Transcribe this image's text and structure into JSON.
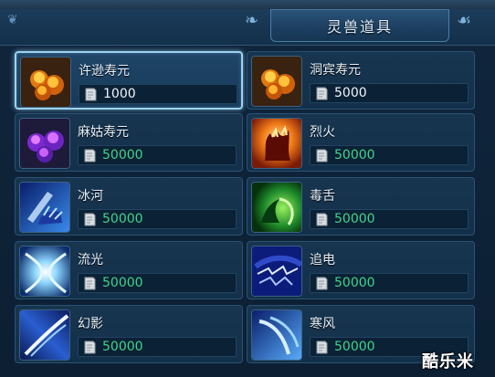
{
  "panel": {
    "title": "灵兽道具"
  },
  "items": [
    {
      "name": "许逊寿元",
      "price": "1000",
      "icon": "golden-orbs-icon",
      "selected": true
    },
    {
      "name": "洞宾寿元",
      "price": "5000",
      "icon": "golden-orbs-icon",
      "selected": false
    },
    {
      "name": "麻姑寿元",
      "price": "50000",
      "icon": "purple-orbs-icon",
      "selected": false
    },
    {
      "name": "烈火",
      "price": "50000",
      "icon": "fire-claw-icon",
      "selected": false
    },
    {
      "name": "冰河",
      "price": "50000",
      "icon": "ice-claw-icon",
      "selected": false
    },
    {
      "name": "毒舌",
      "price": "50000",
      "icon": "poison-tongue-icon",
      "selected": false
    },
    {
      "name": "流光",
      "price": "50000",
      "icon": "light-streak-icon",
      "selected": false
    },
    {
      "name": "追电",
      "price": "50000",
      "icon": "lightning-icon",
      "selected": false
    },
    {
      "name": "幻影",
      "price": "50000",
      "icon": "phantom-icon",
      "selected": false
    },
    {
      "name": "寒风",
      "price": "50000",
      "icon": "cold-wind-icon",
      "selected": false
    }
  ],
  "watermark": "酷乐米",
  "colors": {
    "price_default": "#f2f6fa",
    "price_green": "#3fd58a",
    "selected_border": "#9cd3f0"
  }
}
